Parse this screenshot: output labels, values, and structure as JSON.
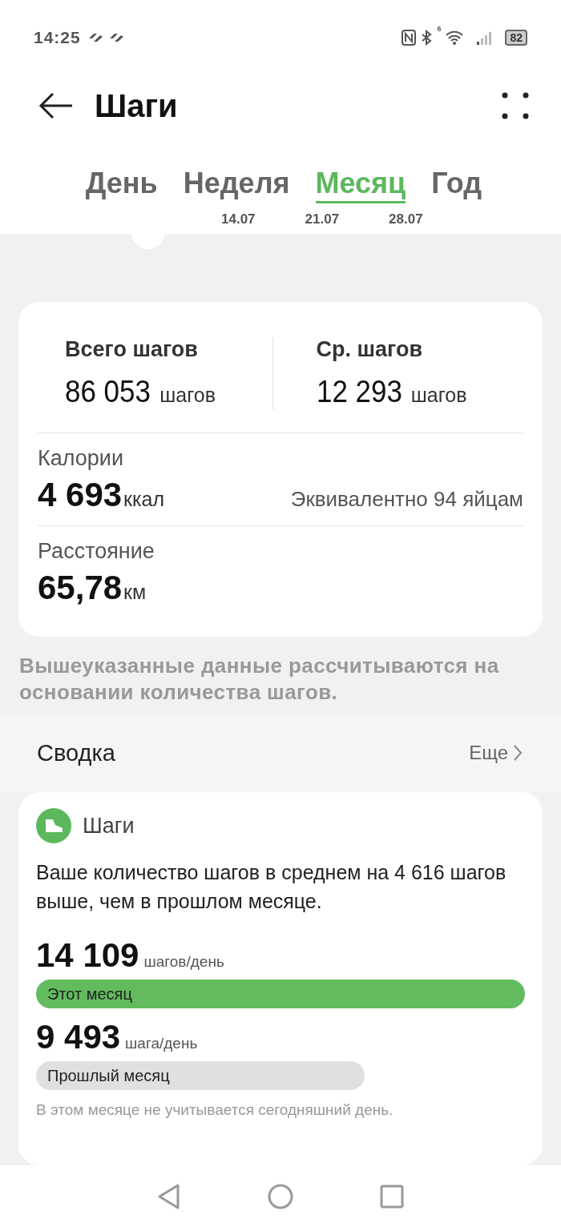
{
  "status_bar": {
    "time": "14:25",
    "wifi_badge": "6",
    "battery": "82"
  },
  "header": {
    "title": "Шаги"
  },
  "tabs": [
    {
      "label": "День",
      "selected": false
    },
    {
      "label": "Неделя",
      "selected": false
    },
    {
      "label": "Месяц",
      "selected": true
    },
    {
      "label": "Год",
      "selected": false
    }
  ],
  "chart_axis": {
    "labels": [
      "14.07",
      "21.07",
      "28.07"
    ]
  },
  "stats": {
    "total": {
      "label": "Всего шагов",
      "value": "86 053",
      "unit": "шагов"
    },
    "average": {
      "label": "Ср. шагов",
      "value": "12 293",
      "unit": "шагов"
    },
    "calories": {
      "label": "Калории",
      "value": "4 693",
      "unit": "ккал",
      "equivalent": "Эквивалентно 94 яйцам"
    },
    "distance": {
      "label": "Расстояние",
      "value": "65,78",
      "unit": "км"
    }
  },
  "note": "Вышеуказанные данные рассчитываются на основании количества шагов.",
  "summary": {
    "title": "Сводка",
    "more": "Еще",
    "card_title": "Шаги",
    "text": "Ваше количество шагов в среднем на 4 616 шагов выше, чем в прошлом месяце.",
    "bars": [
      {
        "value": "14 109",
        "unit": "шагов/день",
        "label": "Этот месяц",
        "color": "#62bb5d"
      },
      {
        "value": "9 493",
        "unit": "шага/день",
        "label": "Прошлый месяц",
        "color": "#e0e0e0"
      }
    ],
    "footnote": "В этом месяце не учитывается сегодняшний день."
  }
}
